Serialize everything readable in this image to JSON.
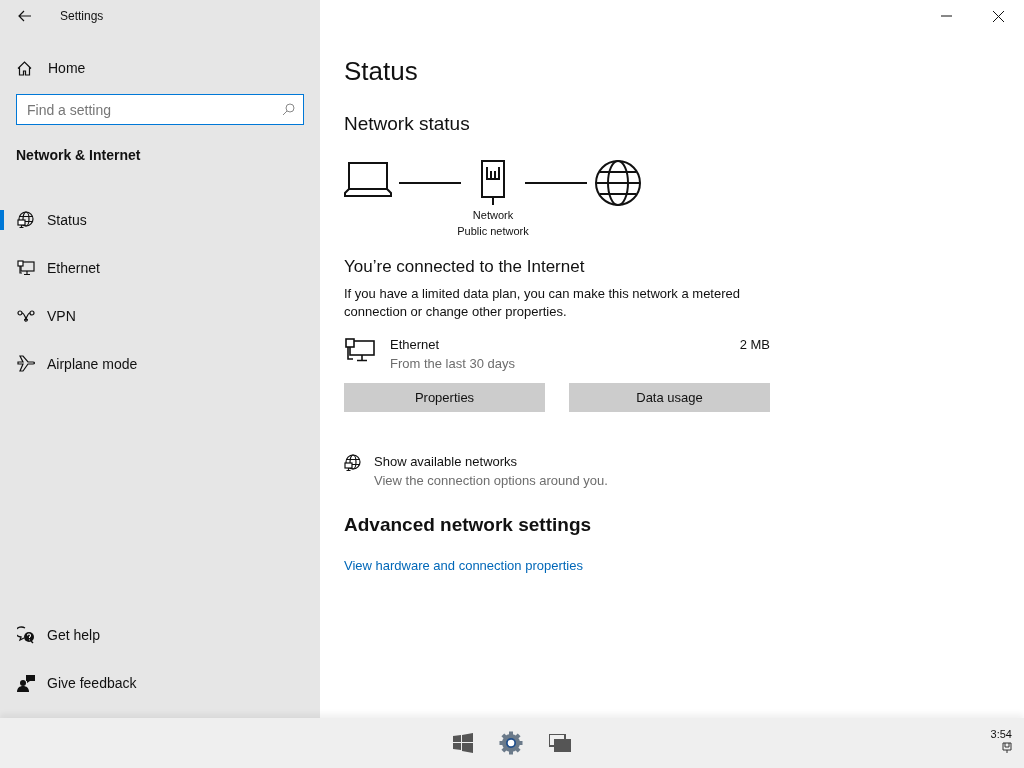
{
  "window": {
    "title": "Settings"
  },
  "sidebar": {
    "home": "Home",
    "search": {
      "placeholder": "Find a setting"
    },
    "section": "Network & Internet",
    "items": [
      {
        "label": "Status",
        "selected": true
      },
      {
        "label": "Ethernet",
        "selected": false
      },
      {
        "label": "VPN",
        "selected": false
      },
      {
        "label": "Airplane mode",
        "selected": false
      }
    ],
    "footer": [
      "Get help",
      "Give feedback"
    ]
  },
  "main": {
    "title": "Status",
    "network_status": {
      "heading": "Network status",
      "network_name": "Network",
      "network_type": "Public network"
    },
    "connected": {
      "heading": "You’re connected to the Internet",
      "text": "If you have a limited data plan, you can make this network a metered connection or change other properties."
    },
    "adapter": {
      "name": "Ethernet",
      "period": "From the last 30 days",
      "usage": "2 MB"
    },
    "buttons": [
      "Properties",
      "Data usage"
    ],
    "show_networks": {
      "title": "Show available networks",
      "subtitle": "View the connection options around you."
    },
    "advanced": {
      "heading": "Advanced network settings",
      "link": "View hardware and connection properties"
    }
  },
  "taskbar": {
    "clock": "3:54"
  }
}
